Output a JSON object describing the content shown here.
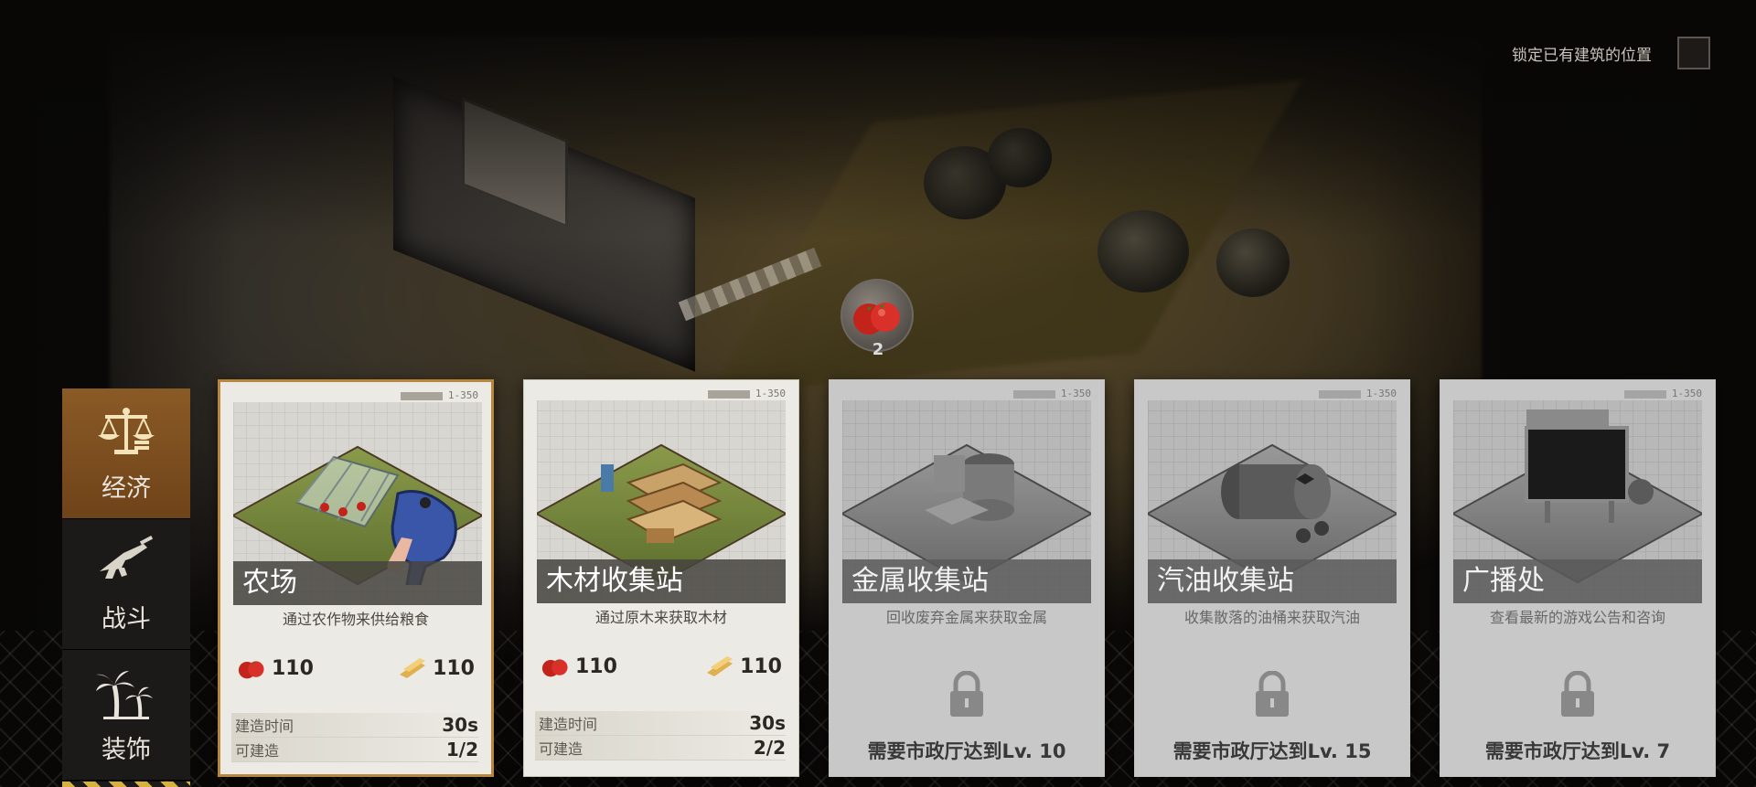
{
  "lock_toggle": {
    "label": "锁定已有建筑的位置",
    "checked": false
  },
  "resource_bubble": {
    "icon": "tomato-icon",
    "count": "2"
  },
  "sidebar": {
    "items": [
      {
        "label": "经济",
        "icon": "scales-icon",
        "active": true
      },
      {
        "label": "战斗",
        "icon": "rifle-icon",
        "active": false
      },
      {
        "label": "装饰",
        "icon": "palm-tree-icon",
        "active": false
      }
    ]
  },
  "card_tag": "1-350",
  "cards": [
    {
      "name": "农场",
      "desc": "通过农作物来供给粮食",
      "costs": [
        {
          "icon": "tomato-icon",
          "value": "110"
        },
        {
          "icon": "wood-plank-icon",
          "value": "110"
        }
      ],
      "build_time_label": "建造时间",
      "build_time": "30s",
      "buildable_label": "可建造",
      "buildable": "1/2",
      "selected": true,
      "locked": false
    },
    {
      "name": "木材收集站",
      "desc": "通过原木来获取木材",
      "costs": [
        {
          "icon": "tomato-icon",
          "value": "110"
        },
        {
          "icon": "wood-plank-icon",
          "value": "110"
        }
      ],
      "build_time_label": "建造时间",
      "build_time": "30s",
      "buildable_label": "可建造",
      "buildable": "2/2",
      "selected": false,
      "locked": false
    },
    {
      "name": "金属收集站",
      "desc": "回收废弃金属来获取金属",
      "requirement": "需要市政厅达到Lv. 10",
      "locked": true
    },
    {
      "name": "汽油收集站",
      "desc": "收集散落的油桶来获取汽油",
      "requirement": "需要市政厅达到Lv. 15",
      "locked": true
    },
    {
      "name": "广播处",
      "desc": "查看最新的游戏公告和咨询",
      "requirement": "需要市政厅达到Lv. 7",
      "locked": true
    }
  ],
  "colors": {
    "active_category": "#7a4c1e",
    "selected_border": "#b8863c",
    "card_bg": "#eceae4"
  }
}
